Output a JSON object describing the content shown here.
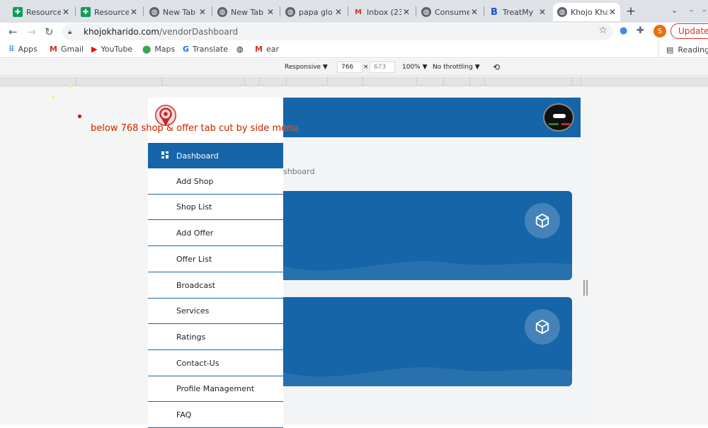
{
  "tabs": [
    {
      "title": "Resource",
      "favicon": "sheets-icon",
      "active": false
    },
    {
      "title": "Resource",
      "favicon": "sheets-icon",
      "active": false
    },
    {
      "title": "New Tab",
      "favicon": "globe-icon",
      "active": false
    },
    {
      "title": "New Tab",
      "favicon": "globe-icon",
      "active": false
    },
    {
      "title": "papa glo",
      "favicon": "globe-icon",
      "active": false
    },
    {
      "title": "Inbox (23",
      "favicon": "gmail-icon",
      "active": false
    },
    {
      "title": "Consume",
      "favicon": "globe-icon",
      "active": false
    },
    {
      "title": "TreatMy",
      "favicon": "b-icon",
      "active": false
    },
    {
      "title": "Khojo Kha",
      "favicon": "globe-icon",
      "active": true
    }
  ],
  "address_bar": {
    "host": "khojokharido.com",
    "path": "/vendorDashboard",
    "update_label": "Update",
    "avatar_letter": "S"
  },
  "bookmarks": {
    "items": [
      {
        "label": "Apps",
        "icon": "apps-grid-icon"
      },
      {
        "label": "Gmail",
        "icon": "gmail-icon"
      },
      {
        "label": "YouTube",
        "icon": "youtube-icon"
      },
      {
        "label": "Maps",
        "icon": "maps-pin-icon"
      },
      {
        "label": "Translate",
        "icon": "translate-icon"
      },
      {
        "label": "",
        "icon": "globe-icon"
      },
      {
        "label": "ear",
        "icon": "gmail-icon"
      }
    ],
    "reading_list": "Reading"
  },
  "devtools": {
    "device": "Responsive",
    "width": "766",
    "times": "×",
    "height": "673",
    "zoom": "100%",
    "throttling": "No throttling"
  },
  "sidebar": {
    "menu": [
      {
        "label": "Dashboard",
        "active": true
      },
      {
        "label": "Add Shop",
        "active": false
      },
      {
        "label": "Shop List",
        "active": false
      },
      {
        "label": "Add Offer",
        "active": false
      },
      {
        "label": "Offer List",
        "active": false
      },
      {
        "label": "Broadcast",
        "active": false
      },
      {
        "label": "Services",
        "active": false
      },
      {
        "label": "Ratings",
        "active": false
      },
      {
        "label": "Contact-Us",
        "active": false
      },
      {
        "label": "Profile Management",
        "active": false
      },
      {
        "label": "FAQ",
        "active": false
      }
    ]
  },
  "main": {
    "breadcrumb": "shboard",
    "cards": [
      {
        "icon": "cube-icon"
      },
      {
        "icon": "cube-icon"
      }
    ]
  },
  "annotation": {
    "text": "below 768 shop & offer tab  cut by side menu"
  },
  "colors": {
    "primary": "#1565a8",
    "annotation": "#c62828",
    "update": "#d93025"
  }
}
